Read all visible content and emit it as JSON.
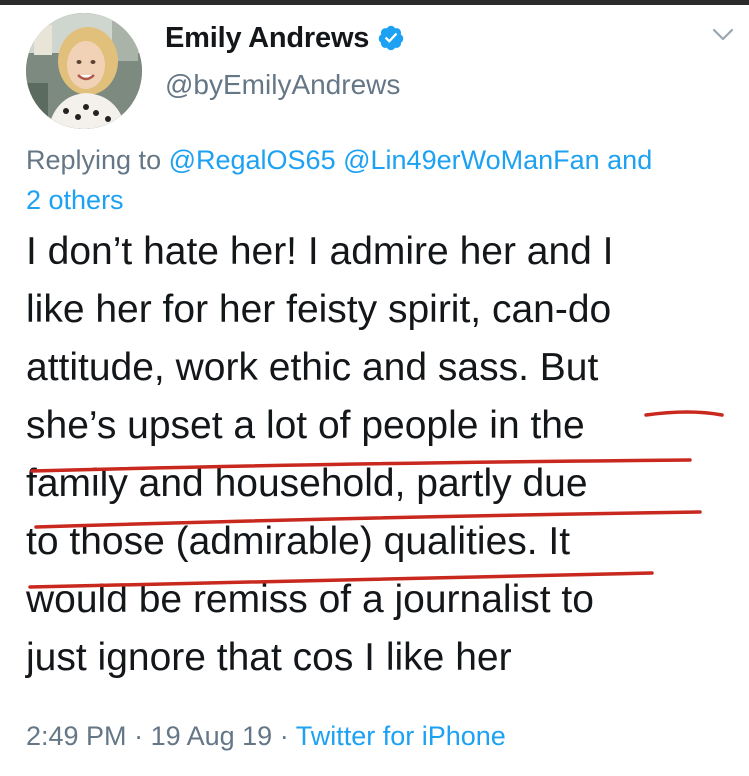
{
  "tweet": {
    "author": {
      "display_name": "Emily Andrews",
      "handle": "@byEmilyAndrews",
      "verified": true
    },
    "replying": {
      "prefix": "Replying to ",
      "mention_1": "@RegalOS65",
      "mention_2": "@Lin49erWoManFan",
      "joiner": " and",
      "others": "2 others"
    },
    "body_lines": [
      "I don’t hate her! I admire her and I",
      "like her for her feisty spirit, can-do",
      "attitude, work ethic and sass. But",
      "she’s upset a lot of people in the",
      "family and household, partly due",
      "to those (admirable) qualities. It",
      "would be remiss of a journalist to",
      "just ignore that cos I like her"
    ],
    "meta": {
      "time": "2:49 PM",
      "sep_1": " · ",
      "date": "19 Aug 19",
      "sep_2": " · ",
      "source": "Twitter for iPhone"
    }
  },
  "icons": {
    "verified": "verified-badge-icon",
    "caret": "chevron-down-icon",
    "avatar": "profile-photo"
  },
  "colors": {
    "link": "#1da1f2",
    "secondary_text": "#657786",
    "primary_text": "#14171a",
    "annotation_underline": "#c8281e"
  }
}
